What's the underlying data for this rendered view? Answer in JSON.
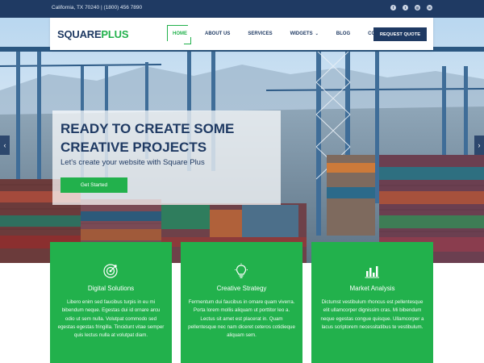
{
  "topbar": {
    "address": "California, TX 70240 | (1800) 456 7890",
    "socials": [
      "facebook-icon",
      "twitter-icon",
      "instagram-icon",
      "linkedin-icon"
    ]
  },
  "header": {
    "logo_part1": "SQUARE",
    "logo_part2": "PLUS",
    "nav": [
      {
        "label": "HOME",
        "active": true
      },
      {
        "label": "ABOUT US",
        "active": false
      },
      {
        "label": "SERVICES",
        "active": false
      },
      {
        "label": "WIDGETS",
        "active": false,
        "dropdown": true
      },
      {
        "label": "BLOG",
        "active": false
      },
      {
        "label": "CONTACT",
        "active": false
      }
    ],
    "cta_label": "REQUEST QUOTE"
  },
  "slide": {
    "title": "READY TO CREATE SOME CREATIVE PROJECTS",
    "subtitle": "Let's create your website with Square Plus",
    "button_label": "Get Started",
    "prev_arrow": "‹",
    "next_arrow": "›"
  },
  "features": [
    {
      "icon": "target-icon",
      "title": "Digital Solutions",
      "body": "Libero enim sed faucibus turpis in eu mi bibendum neque. Egestas dui id ornare arcu odio ut sem nulla. Volutpat commodo sed egestas egestas fringilla. Tincidunt vitae semper quis lectus nulla at volutpat diam."
    },
    {
      "icon": "lightbulb-icon",
      "title": "Creative Strategy",
      "body": "Fermentum dui faucibus in ornare quam viverra. Porta lorem mollis aliquam ut porttitor leo a. Lectus sit amet est placerat in. Quam pellentesque nec nam diceret ceteros cotidieque aliquam sem."
    },
    {
      "icon": "bar-chart-icon",
      "title": "Market Analysis",
      "body": "Dictumst vestibulum rhoncus est pellentesque elit ullamcorper dignissim cras. Mi bibendum neque egestas congue quisque. Ullamcorper a lacus scriptorem necessitatibus te vestibulum."
    }
  ],
  "colors": {
    "navy": "#1f3a63",
    "green": "#22b14c"
  }
}
